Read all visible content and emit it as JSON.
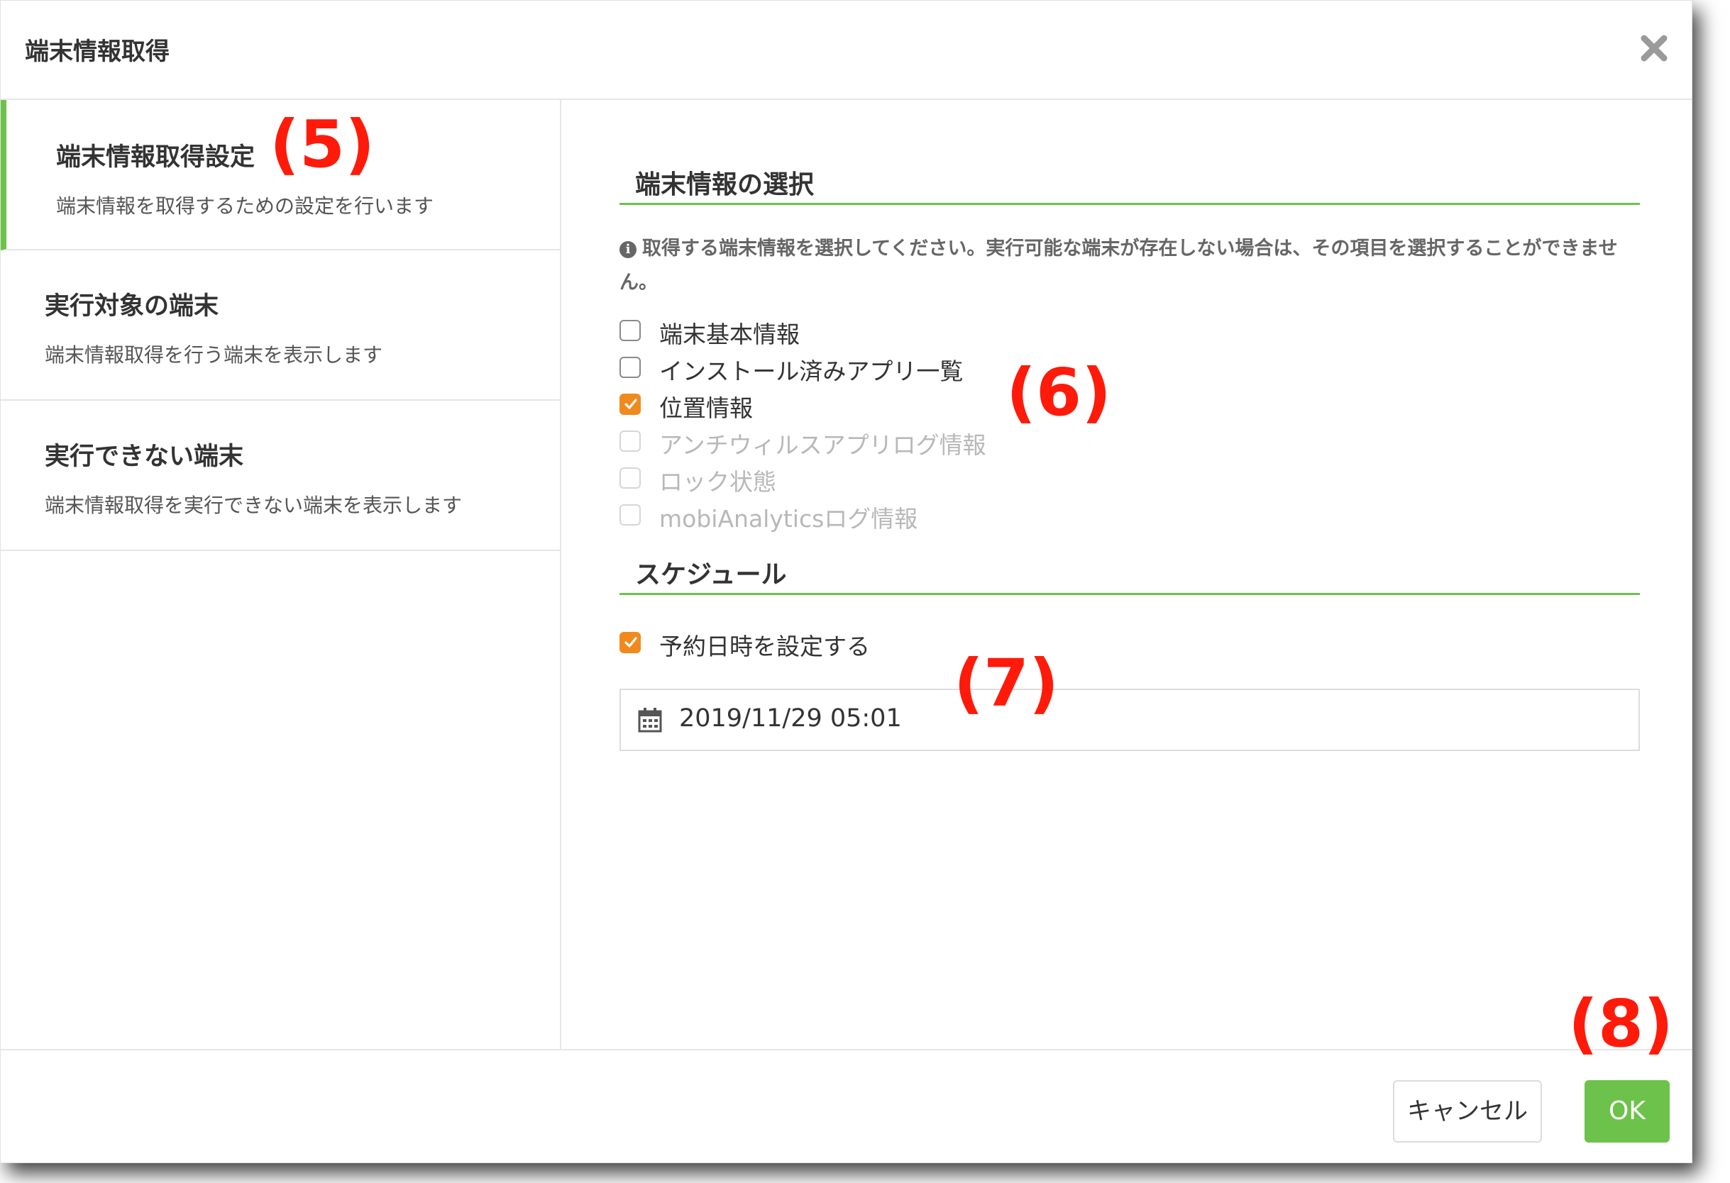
{
  "dialog": {
    "title": "端末情報取得"
  },
  "sidebar": {
    "items": [
      {
        "title": "端末情報取得設定",
        "desc": "端末情報を取得するための設定を行います",
        "active": true
      },
      {
        "title": "実行対象の端末",
        "desc": "端末情報取得を行う端末を表示します",
        "active": false
      },
      {
        "title": "実行できない端末",
        "desc": "端末情報取得を実行できない端末を表示します",
        "active": false
      }
    ]
  },
  "info_section": {
    "title": "端末情報の選択",
    "info_text": "取得する端末情報を選択してください。実行可能な端末が存在しない場合は、その項目を選択することができません。",
    "options": [
      {
        "label": "端末基本情報",
        "checked": false,
        "disabled": false
      },
      {
        "label": "インストール済みアプリ一覧",
        "checked": false,
        "disabled": false
      },
      {
        "label": "位置情報",
        "checked": true,
        "disabled": false
      },
      {
        "label": "アンチウィルスアプリログ情報",
        "checked": false,
        "disabled": true
      },
      {
        "label": "ロック状態",
        "checked": false,
        "disabled": true
      },
      {
        "label": "mobiAnalyticsログ情報",
        "checked": false,
        "disabled": true
      }
    ]
  },
  "schedule": {
    "title": "スケジュール",
    "option_label": "予約日時を設定する",
    "option_checked": true,
    "datetime": "2019/11/29 05:01"
  },
  "footer": {
    "cancel_label": "キャンセル",
    "ok_label": "OK"
  },
  "annotations": [
    "(5)",
    "(6)",
    "(7)",
    "(8)"
  ],
  "colors": {
    "accent": "#6cc24a",
    "check": "#f08a1c",
    "annotation": "#ff1a0a"
  }
}
